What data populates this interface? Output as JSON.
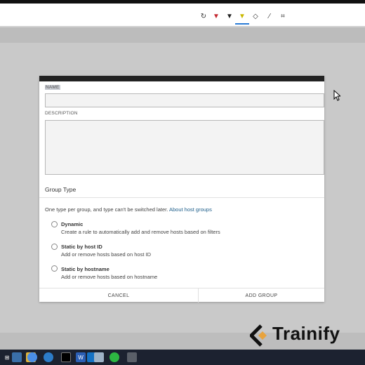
{
  "toolbar": {
    "tools": [
      {
        "name": "lasso-icon",
        "glyph": "↻"
      },
      {
        "name": "pen-red-icon",
        "glyph": "▼"
      },
      {
        "name": "pen-dark-icon",
        "glyph": "▼"
      },
      {
        "name": "highlighter-icon",
        "glyph": "▼"
      },
      {
        "name": "eraser-icon",
        "glyph": "◇"
      },
      {
        "name": "ruler-icon",
        "glyph": "⁄"
      },
      {
        "name": "crop-icon",
        "glyph": "⌗"
      }
    ],
    "active_index": 3
  },
  "modal": {
    "name_label": "NAME",
    "name_value": "",
    "description_label": "DESCRIPTION",
    "description_value": "",
    "group_type_title": "Group Type",
    "group_type_desc": "One type per group, and type can't be switched later.",
    "group_type_link": "About host groups",
    "options": [
      {
        "title": "Dynamic",
        "desc": "Create a rule to automatically add and remove hosts based on filters"
      },
      {
        "title": "Static by host ID",
        "desc": "Add or remove hosts based on host ID"
      },
      {
        "title": "Static by hostname",
        "desc": "Add or remove hosts based on hostname"
      }
    ],
    "cancel_label": "CANCEL",
    "add_group_label": "ADD GROUP"
  },
  "brand": {
    "logo_text": "Trainify",
    "accent_color": "#e8a33d"
  },
  "taskbar": {
    "icons": [
      "windows-icon",
      "file-explorer-icon",
      "folder-icon",
      "chrome-icon",
      "settings-icon",
      "terminal-icon",
      "word-icon",
      "outlook-icon",
      "paint-icon",
      "whatsapp-icon",
      "app-icon"
    ]
  }
}
